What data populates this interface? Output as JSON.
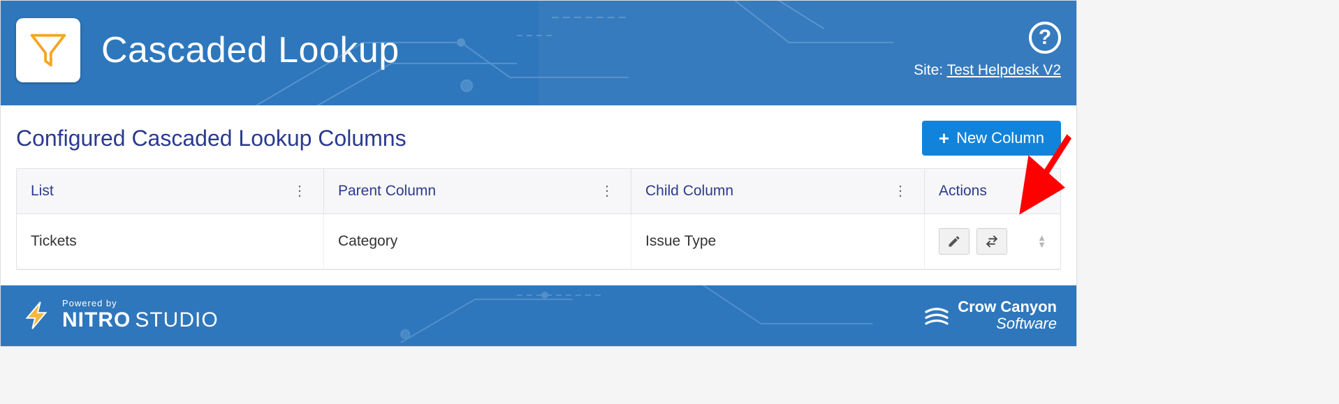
{
  "header": {
    "title": "Cascaded Lookup",
    "site_label": "Site:",
    "site_name": "Test Helpdesk V2",
    "help_symbol": "?"
  },
  "section": {
    "title": "Configured Cascaded Lookup Columns",
    "new_button": "New Column"
  },
  "grid": {
    "columns": {
      "list": "List",
      "parent": "Parent Column",
      "child": "Child Column",
      "actions": "Actions"
    },
    "rows": [
      {
        "list": "Tickets",
        "parent": "Category",
        "child": "Issue Type"
      }
    ]
  },
  "footer": {
    "powered_by": "Powered by",
    "nitro": "NITRO",
    "studio": "STUDIO",
    "company_top": "Crow Canyon",
    "company_bottom": "Software"
  }
}
